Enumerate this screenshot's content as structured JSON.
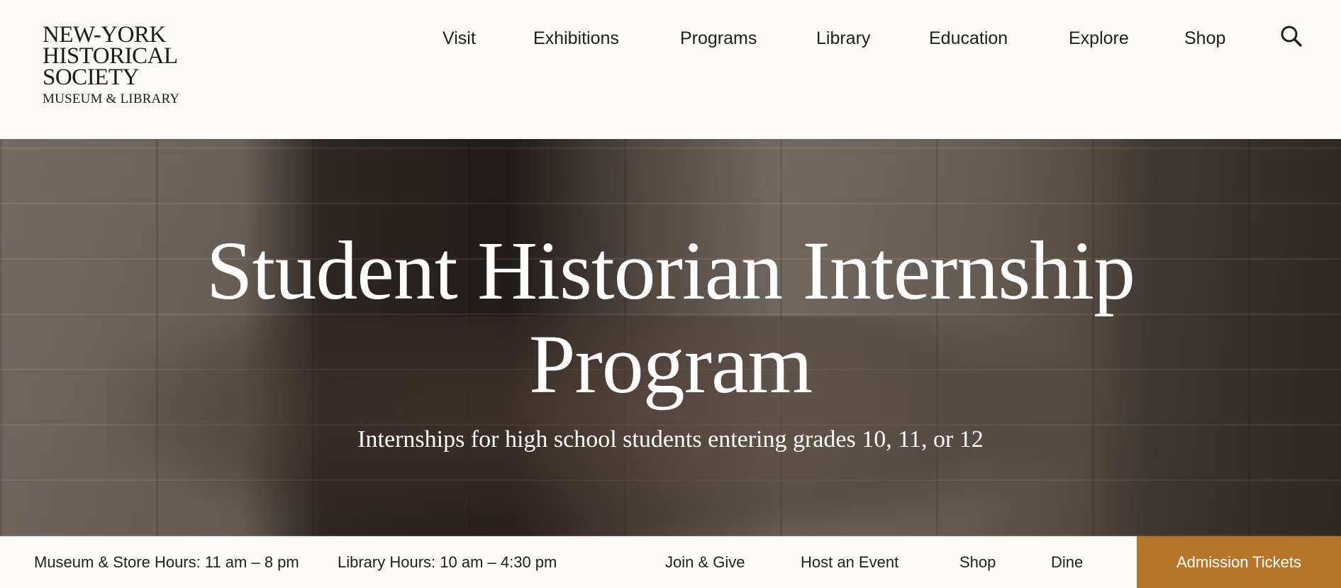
{
  "logo": {
    "line1": "NEW-YORK",
    "line2": "HISTORICAL",
    "line3": "SOCIETY",
    "line4": "MUSEUM & LIBRARY"
  },
  "nav": {
    "items": [
      {
        "label": "Visit"
      },
      {
        "label": "Exhibitions"
      },
      {
        "label": "Programs"
      },
      {
        "label": "Library"
      },
      {
        "label": "Education"
      },
      {
        "label": "Explore"
      },
      {
        "label": "Shop"
      }
    ],
    "search_icon": "search-icon"
  },
  "hero": {
    "title_line1": "Student Historian Internship",
    "title_line2": "Program",
    "subtitle": "Internships for high school students entering grades 10, 11, or 12"
  },
  "bottom_bar": {
    "museum_hours": "Museum & Store Hours: 11 am – 8 pm",
    "library_hours": "Library Hours: 10 am – 4:30 pm",
    "links": [
      {
        "label": "Join & Give"
      },
      {
        "label": "Host an Event"
      },
      {
        "label": "Shop"
      },
      {
        "label": "Dine"
      }
    ],
    "tickets_label": "Admission Tickets"
  },
  "colors": {
    "background": "#fdfbf7",
    "accent": "#b5762a",
    "text": "#1f1f1f"
  }
}
